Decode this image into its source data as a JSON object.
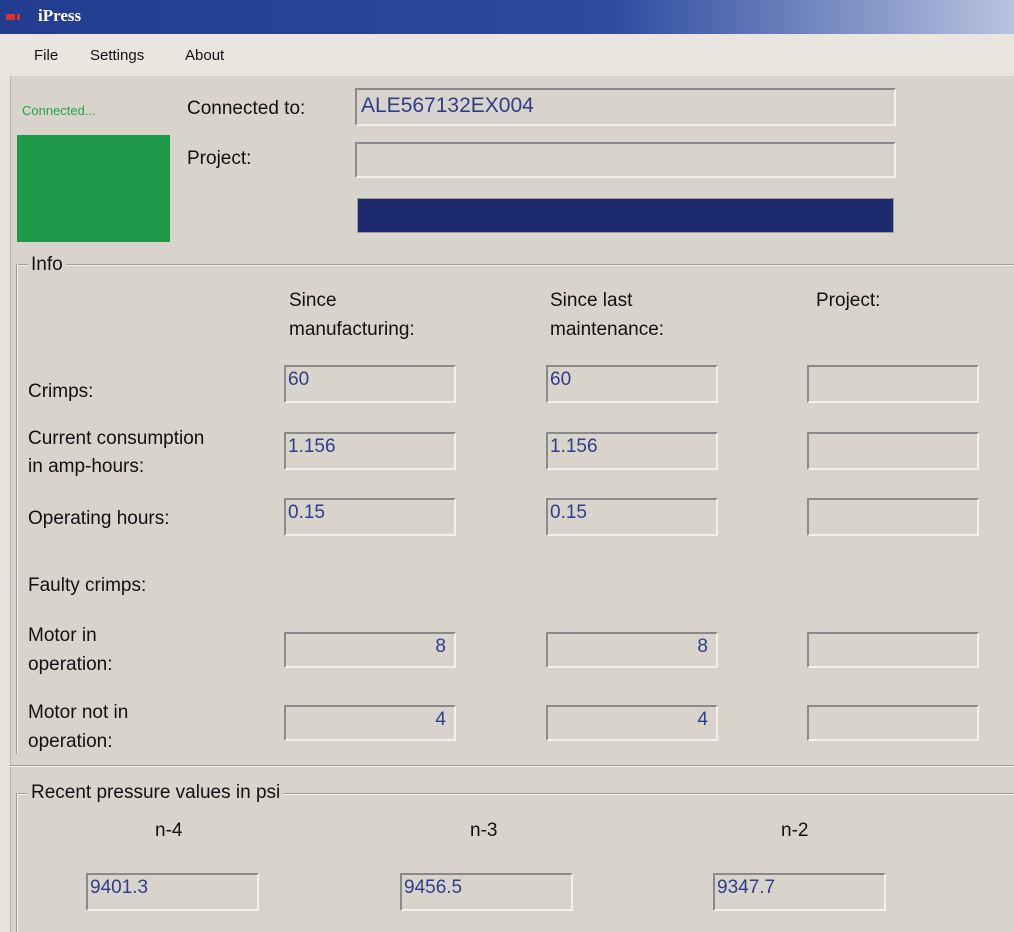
{
  "app": {
    "title": "iPress"
  },
  "menu": {
    "file": "File",
    "settings": "Settings",
    "about": "About"
  },
  "connection": {
    "status_text": "Connected...",
    "status_color": "#1e9849",
    "connected_to_label": "Connected to:",
    "connected_to_value": "ALE567132EX004",
    "project_label": "Project:",
    "project_value": "",
    "progress_fraction": 1.0
  },
  "info": {
    "title": "Info",
    "columns": {
      "since_manufacturing": [
        "Since",
        "manufacturing:"
      ],
      "since_maintenance": [
        "Since last",
        "maintenance:"
      ],
      "project": "Project:"
    },
    "rows": {
      "crimps": {
        "label": "Crimps:",
        "manufacturing": "60",
        "maintenance": "60",
        "project": ""
      },
      "current": {
        "label": [
          "Current consumption",
          "in amp-hours:"
        ],
        "manufacturing": "1.156",
        "maintenance": "1.156",
        "project": ""
      },
      "operating": {
        "label": "Operating hours:",
        "manufacturing": "0.15",
        "maintenance": "0.15",
        "project": ""
      },
      "faulty_header": "Faulty crimps:",
      "motor_on": {
        "label": [
          "Motor in",
          "operation:"
        ],
        "manufacturing": "8",
        "maintenance": "8",
        "project": ""
      },
      "motor_off": {
        "label": [
          "Motor not in",
          "operation:"
        ],
        "manufacturing": "4",
        "maintenance": "4",
        "project": ""
      }
    }
  },
  "pressure": {
    "title": "Recent pressure values in psi",
    "items": [
      {
        "label": "n-4",
        "value": "9401.3"
      },
      {
        "label": "n-3",
        "value": "9456.5"
      },
      {
        "label": "n-2",
        "value": "9347.7"
      }
    ]
  }
}
